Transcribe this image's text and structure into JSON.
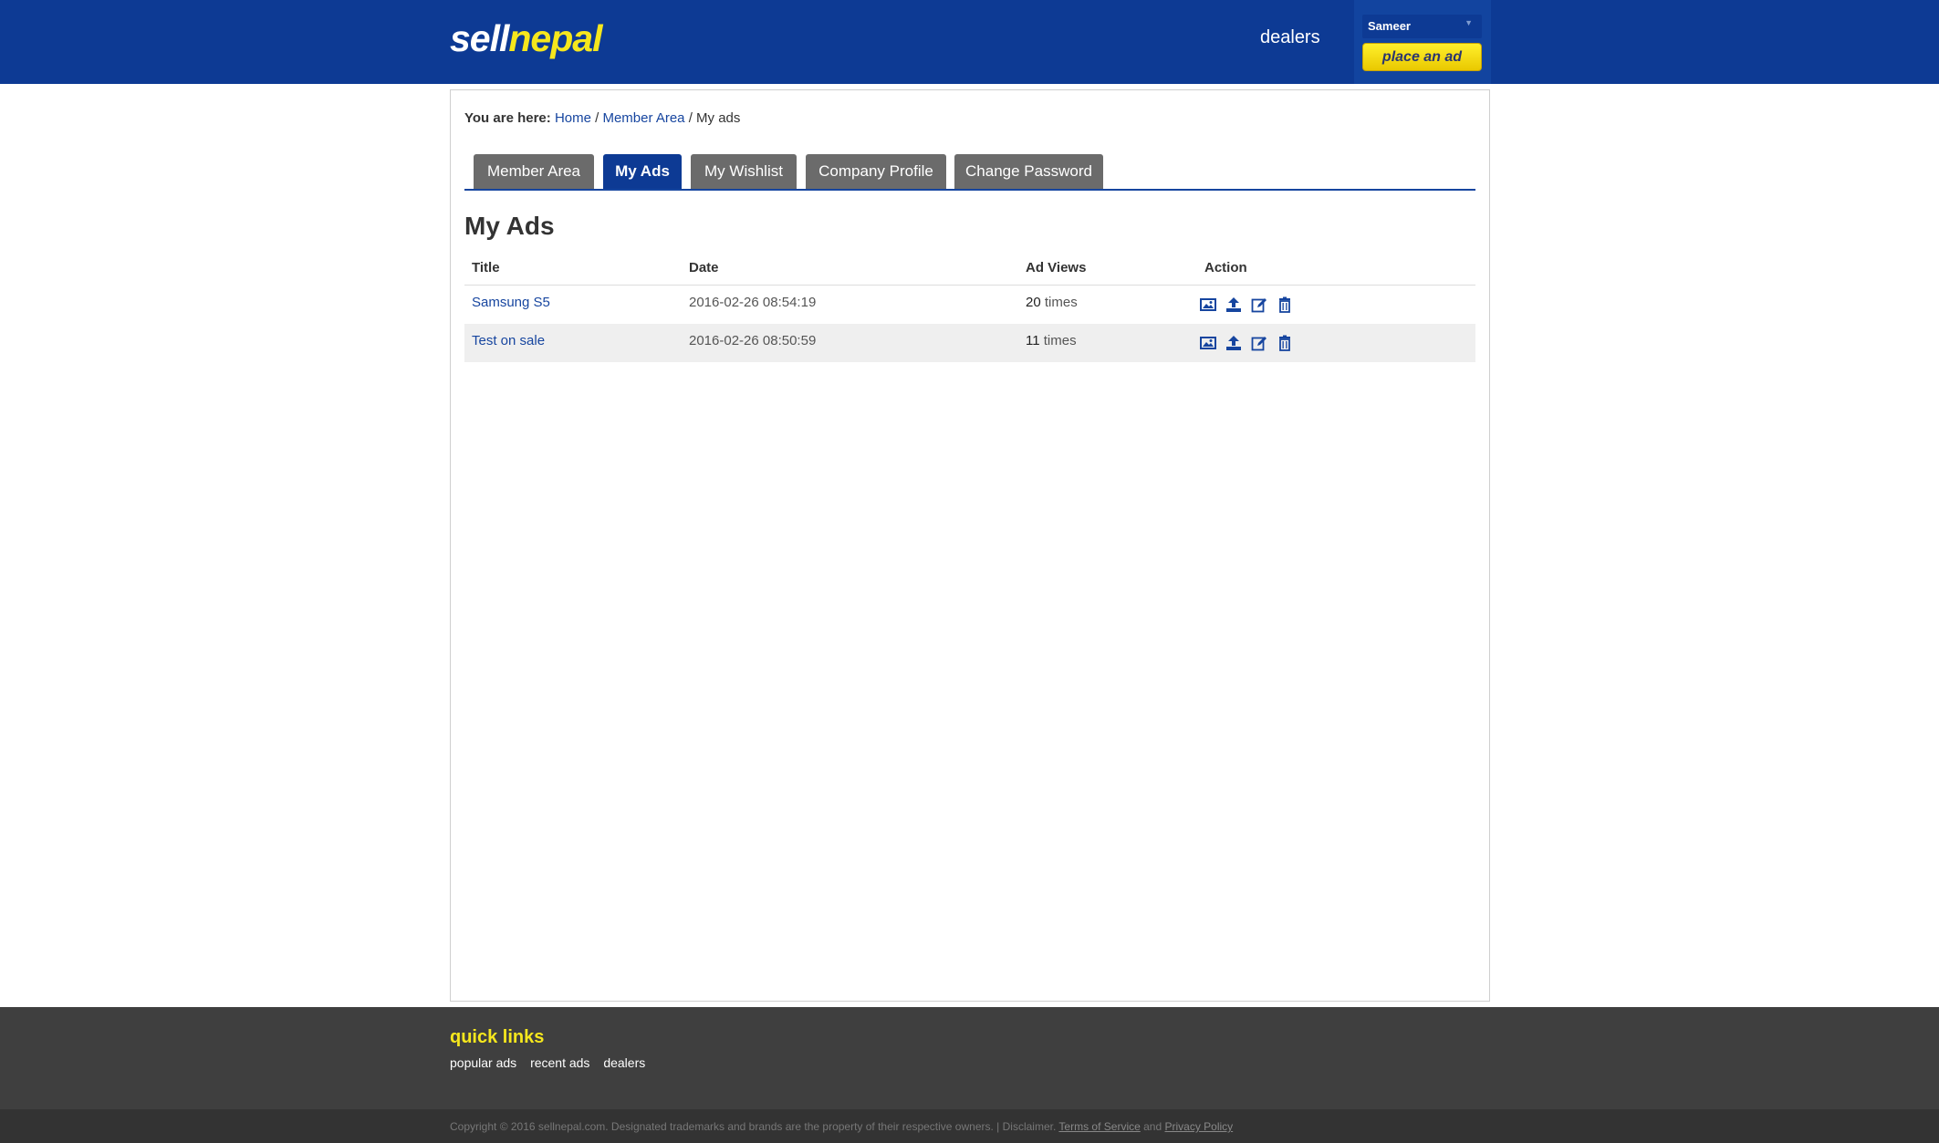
{
  "header": {
    "logo_part1": "sell",
    "logo_part2": "nepal",
    "nav_dealers": "dealers",
    "user_name": "Sameer",
    "place_ad": "place an ad"
  },
  "breadcrumb": {
    "prefix": "You are here:",
    "home": "Home",
    "sep1": "/",
    "member_area": "Member Area",
    "sep2": "/",
    "current": "My ads"
  },
  "tabs": [
    {
      "label": "Member Area",
      "active": false
    },
    {
      "label": "My Ads",
      "active": true
    },
    {
      "label": "My Wishlist",
      "active": false
    },
    {
      "label": "Company Profile",
      "active": false
    },
    {
      "label": "Change Password",
      "active": false
    }
  ],
  "page_title": "My Ads",
  "table": {
    "headers": [
      "Title",
      "Date",
      "Ad Views",
      "Action"
    ],
    "rows": [
      {
        "title": "Samsung S5",
        "date": "2016-02-26 08:54:19",
        "views": "20",
        "views_suffix": " times"
      },
      {
        "title": "Test on sale",
        "date": "2016-02-26 08:50:59",
        "views": "11",
        "views_suffix": " times"
      }
    ],
    "action_icons": [
      "image-icon",
      "upload-icon",
      "edit-icon",
      "trash-icon"
    ]
  },
  "footer": {
    "quick_links_title": "quick links",
    "links": [
      "popular ads",
      "recent ads",
      "dealers"
    ],
    "copyright_text": "Copyright © 2016 sellnepal.com. Designated trademarks and brands are the property of their respective owners. | Disclaimer.",
    "terms": "Terms of Service",
    "and": "and",
    "privacy": "Privacy Policy"
  },
  "colors": {
    "brand_blue": "#0d3a94",
    "brand_yellow": "#f6e71d",
    "tab_inactive": "#6b6b6b",
    "link": "#16459f"
  }
}
